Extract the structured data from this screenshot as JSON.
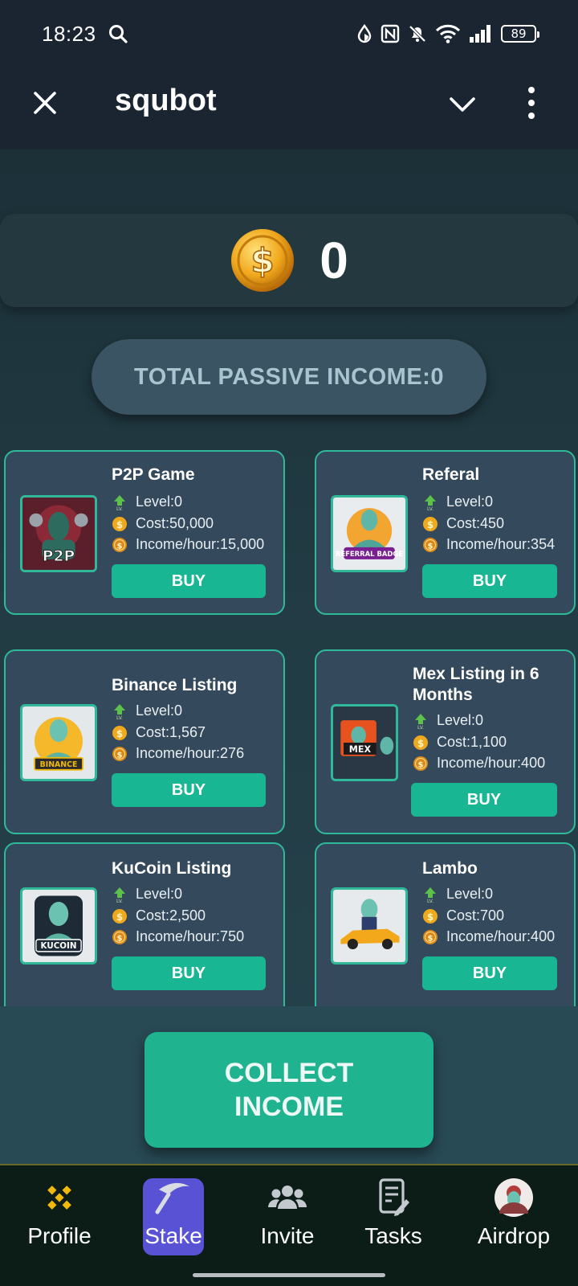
{
  "status_bar": {
    "time": "18:23",
    "battery": "89"
  },
  "header": {
    "title": "squbot"
  },
  "balance": {
    "value": "0"
  },
  "passive_income": {
    "label": "TOTAL PASSIVE INCOME:0"
  },
  "cards": [
    {
      "title": "P2P Game",
      "level": "Level:0",
      "cost": "Cost:50,000",
      "income": "Income/hour:15,000",
      "buy": "BUY",
      "badge": "P2P"
    },
    {
      "title": "Referal",
      "level": "Level:0",
      "cost": "Cost:450",
      "income": "Income/hour:354",
      "buy": "BUY",
      "badge": "REFERRAL BADGE"
    },
    {
      "title": "Binance Listing",
      "level": "Level:0",
      "cost": "Cost:1,567",
      "income": "Income/hour:276",
      "buy": "BUY",
      "badge": "BINANCE"
    },
    {
      "title": "Mex Listing in 6 Months",
      "level": "Level:0",
      "cost": "Cost:1,100",
      "income": "Income/hour:400",
      "buy": "BUY",
      "badge": "MEX"
    },
    {
      "title": "KuCoin Listing",
      "level": "Level:0",
      "cost": "Cost:2,500",
      "income": "Income/hour:750",
      "buy": "BUY",
      "badge": "KUCOIN"
    },
    {
      "title": "Lambo",
      "level": "Level:0",
      "cost": "Cost:700",
      "income": "Income/hour:400",
      "buy": "BUY",
      "badge": ""
    }
  ],
  "collect": {
    "line1": "COLLECT",
    "line2": "INCOME"
  },
  "nav": [
    {
      "label": "Profile",
      "icon": "binance-icon"
    },
    {
      "label": "Stake",
      "icon": "pickaxe-icon",
      "active": true
    },
    {
      "label": "Invite",
      "icon": "users-icon"
    },
    {
      "label": "Tasks",
      "icon": "tasks-icon"
    },
    {
      "label": "Airdrop",
      "icon": "avatar-icon"
    }
  ],
  "colors": {
    "accent": "#19b693",
    "active_nav": "#5a52d5",
    "card_bg": "#344a5c",
    "card_border": "#2fb99a"
  }
}
